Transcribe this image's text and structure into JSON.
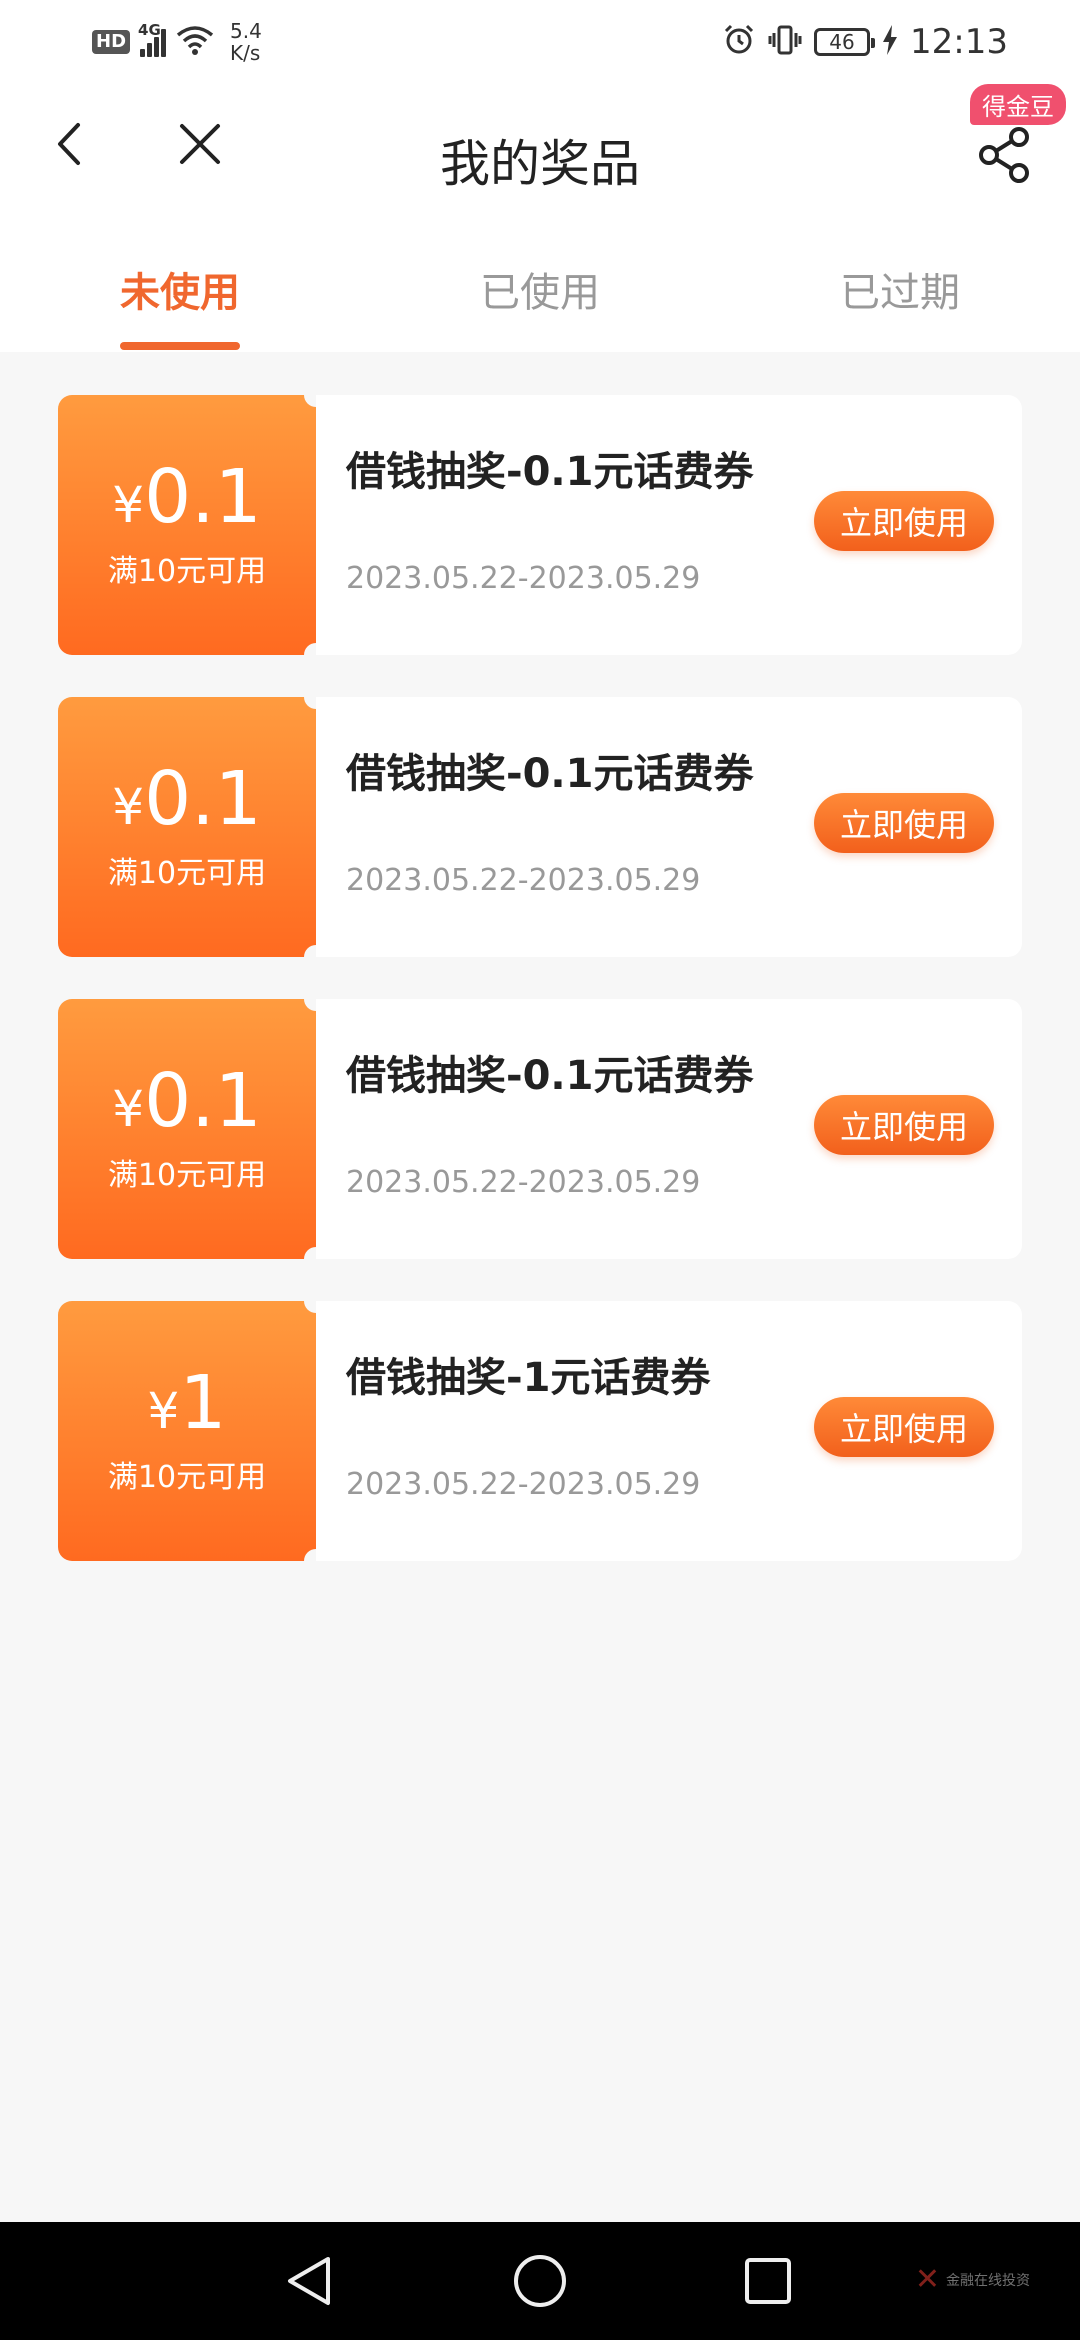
{
  "status_bar": {
    "hd": "HD",
    "network": "4G",
    "speed_value": "5.4",
    "speed_unit": "K/s",
    "battery": "46",
    "time": "12:13",
    "icons": [
      "signal-icon",
      "wifi-icon",
      "alarm-icon",
      "vibrate-icon",
      "battery-icon",
      "charging-icon"
    ]
  },
  "header": {
    "title": "我的奖品",
    "badge": "得金豆",
    "icons": [
      "back-icon",
      "close-icon",
      "share-icon"
    ]
  },
  "tabs": [
    {
      "label": "未使用",
      "active": true
    },
    {
      "label": "已使用",
      "active": false
    },
    {
      "label": "已过期",
      "active": false
    }
  ],
  "coupons": [
    {
      "currency": "¥",
      "amount": "0.1",
      "threshold": "满10元可用",
      "title": "借钱抽奖-0.1元话费券",
      "date": "2023.05.22-2023.05.29",
      "button": "立即使用"
    },
    {
      "currency": "¥",
      "amount": "0.1",
      "threshold": "满10元可用",
      "title": "借钱抽奖-0.1元话费券",
      "date": "2023.05.22-2023.05.29",
      "button": "立即使用"
    },
    {
      "currency": "¥",
      "amount": "0.1",
      "threshold": "满10元可用",
      "title": "借钱抽奖-0.1元话费券",
      "date": "2023.05.22-2023.05.29",
      "button": "立即使用"
    },
    {
      "currency": "¥",
      "amount": "1",
      "threshold": "满10元可用",
      "title": "借钱抽奖-1元话费券",
      "date": "2023.05.22-2023.05.29",
      "button": "立即使用"
    }
  ],
  "colors": {
    "accent": "#f0672e",
    "coupon_gradient_top": "#ff9b3f",
    "coupon_gradient_bottom": "#ff6a20",
    "badge": "#f0506e"
  },
  "nav": {
    "icons": [
      "nav-back-icon",
      "nav-home-icon",
      "nav-recents-icon"
    ],
    "watermark": "金融在线投资"
  }
}
